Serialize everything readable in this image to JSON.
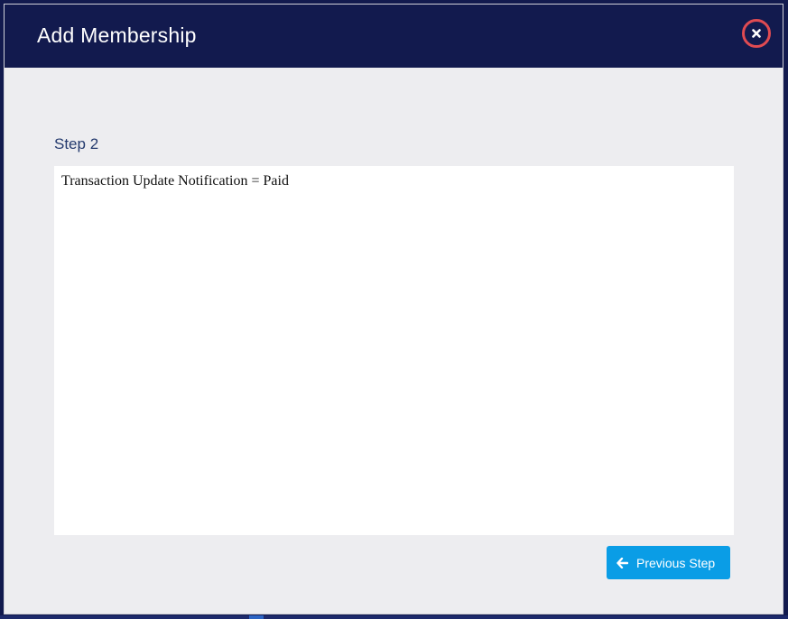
{
  "modal": {
    "title": "Add Membership",
    "close_icon": "close-icon"
  },
  "step": {
    "label": "Step 2"
  },
  "content": {
    "text": "Transaction Update Notification = Paid"
  },
  "actions": {
    "previous_label": "Previous Step",
    "previous_icon": "arrow-left-icon"
  },
  "colors": {
    "header": "#121a4e",
    "close_ring": "#e04b52",
    "primary_button": "#0a9de6",
    "step_label": "#243a6e"
  }
}
